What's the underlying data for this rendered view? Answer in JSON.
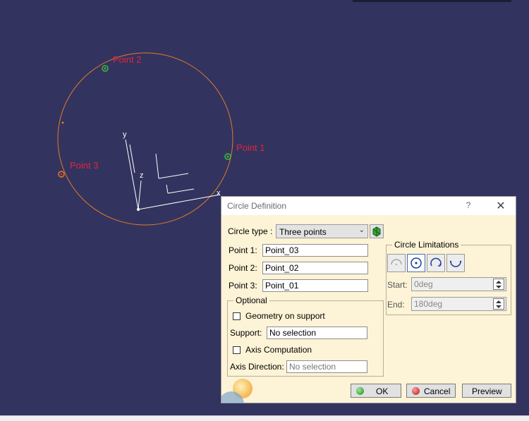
{
  "viewport": {
    "point_labels": [
      "Point 1",
      "Point 2",
      "Point 3"
    ],
    "axis_labels": {
      "x": "x",
      "y": "y",
      "z": "z"
    },
    "colors": {
      "background": "#33335f",
      "circle": "#e07a2a",
      "point_label": "#e0253a",
      "point_marker": "#3cbc3c",
      "axes": "#ffffff"
    }
  },
  "dialog": {
    "title": "Circle Definition",
    "help_label": "?",
    "close_label": "✕",
    "circle_type": {
      "label": "Circle type :",
      "value": "Three points"
    },
    "points": [
      {
        "label": "Point 1:",
        "value": "Point_03"
      },
      {
        "label": "Point 2:",
        "value": "Point_02"
      },
      {
        "label": "Point 3:",
        "value": "Point_01"
      }
    ],
    "optional": {
      "title": "Optional",
      "geometry_on_support": {
        "label": "Geometry on support",
        "checked": false
      },
      "support": {
        "label": "Support:",
        "value": "No selection"
      },
      "axis_computation": {
        "label": "Axis Computation",
        "checked": false
      },
      "axis_direction": {
        "label": "Axis Direction:",
        "value": "No selection"
      }
    },
    "limitations": {
      "title": "Circle Limitations",
      "buttons": [
        "part-arc-icon",
        "whole-circle-icon",
        "trimmed-circle-icon",
        "complementary-circle-icon"
      ],
      "start": {
        "label": "Start:",
        "value": "0deg"
      },
      "end": {
        "label": "End:",
        "value": "180deg"
      }
    },
    "buttons": {
      "ok": "OK",
      "cancel": "Cancel",
      "preview": "Preview"
    }
  }
}
